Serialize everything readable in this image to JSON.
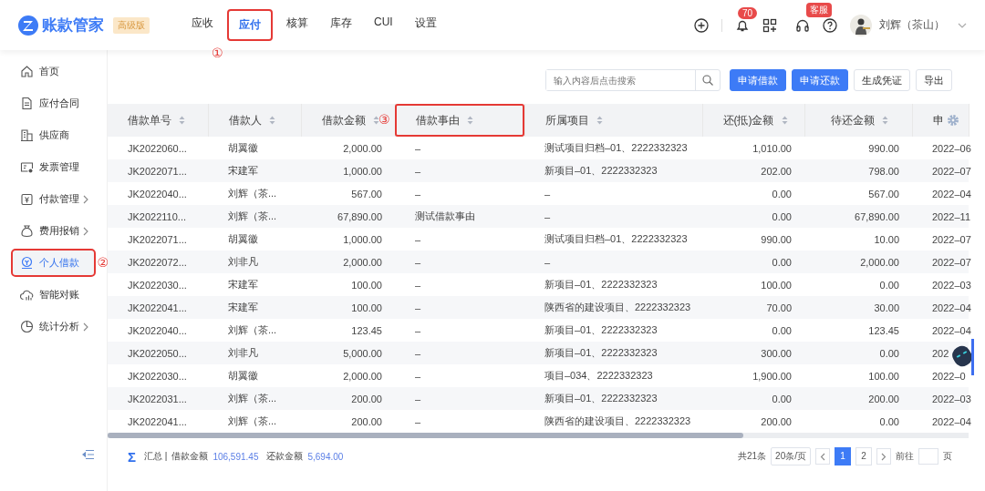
{
  "header": {
    "logo_text": "账款管家",
    "edition_badge": "高级版",
    "nav": [
      {
        "label": "应收",
        "selected": false
      },
      {
        "label": "应付",
        "selected": true,
        "annotation": "①"
      },
      {
        "label": "核算",
        "selected": false
      },
      {
        "label": "库存",
        "selected": false
      },
      {
        "label": "CUI",
        "selected": false
      },
      {
        "label": "设置",
        "selected": false
      }
    ],
    "notification_count": "70",
    "support_badge": "客服",
    "user_name": "刘辉（茶山）"
  },
  "sidebar": {
    "items": [
      {
        "label": "首页",
        "selected": false,
        "has_submenu": false
      },
      {
        "label": "应付合同",
        "selected": false,
        "has_submenu": false
      },
      {
        "label": "供应商",
        "selected": false,
        "has_submenu": false
      },
      {
        "label": "发票管理",
        "selected": false,
        "has_submenu": false
      },
      {
        "label": "付款管理",
        "selected": false,
        "has_submenu": true
      },
      {
        "label": "费用报销",
        "selected": false,
        "has_submenu": true
      },
      {
        "label": "个人借款",
        "selected": true,
        "has_submenu": false,
        "annotation": "②"
      },
      {
        "label": "智能对账",
        "selected": false,
        "has_submenu": false
      },
      {
        "label": "统计分析",
        "selected": false,
        "has_submenu": true
      }
    ]
  },
  "toolbar": {
    "search": {
      "placeholder": "输入内容后点击搜索"
    },
    "buttons": [
      {
        "label": "申请借款",
        "kind": "primary"
      },
      {
        "label": "申请还款",
        "kind": "primary"
      },
      {
        "label": "生成凭证",
        "kind": "plain"
      },
      {
        "label": "导出",
        "kind": "plain"
      }
    ]
  },
  "table": {
    "columns": [
      {
        "label": "借款单号",
        "kind": "text",
        "sortable": true
      },
      {
        "label": "借款人",
        "kind": "text",
        "sortable": true
      },
      {
        "label": "借款金额",
        "kind": "amount",
        "sortable": true
      },
      {
        "label": "借款事由",
        "kind": "text",
        "sortable": true,
        "annotation": "③"
      },
      {
        "label": "所属项目",
        "kind": "text",
        "sortable": true
      },
      {
        "label": "还(抵)金额",
        "kind": "amount",
        "sortable": true
      },
      {
        "label": "待还金额",
        "kind": "amount",
        "sortable": true
      },
      {
        "label": "申",
        "kind": "text",
        "sortable": false
      }
    ],
    "rows": [
      [
        "JK2022060...",
        "胡翼徽",
        "2,000.00",
        "–",
        "测试项目归档–01、2222332323",
        "1,010.00",
        "990.00",
        "2022–06"
      ],
      [
        "JK2022071...",
        "宋建军",
        "1,000.00",
        "–",
        "新项目–01、2222332323",
        "202.00",
        "798.00",
        "2022–07"
      ],
      [
        "JK2022040...",
        "刘辉（茶...",
        "567.00",
        "–",
        "–",
        "0.00",
        "567.00",
        "2022–04"
      ],
      [
        "JK2022110...",
        "刘辉（茶...",
        "67,890.00",
        "测试借款事由",
        "–",
        "0.00",
        "67,890.00",
        "2022–11"
      ],
      [
        "JK2022071...",
        "胡翼徽",
        "1,000.00",
        "–",
        "测试项目归档–01、2222332323",
        "990.00",
        "10.00",
        "2022–07"
      ],
      [
        "JK2022072...",
        "刘非凡",
        "2,000.00",
        "–",
        "–",
        "0.00",
        "2,000.00",
        "2022–07"
      ],
      [
        "JK2022030...",
        "宋建军",
        "100.00",
        "–",
        "新项目–01、2222332323",
        "100.00",
        "0.00",
        "2022–03"
      ],
      [
        "JK2022041...",
        "宋建军",
        "100.00",
        "–",
        "陕西省的建设项目、2222332323",
        "70.00",
        "30.00",
        "2022–04"
      ],
      [
        "JK2022040...",
        "刘辉（茶...",
        "123.45",
        "–",
        "新项目–01、2222332323",
        "0.00",
        "123.45",
        "2022–04"
      ],
      [
        "JK2022050...",
        "刘非凡",
        "5,000.00",
        "–",
        "新项目–01、2222332323",
        "300.00",
        "0.00",
        "202"
      ],
      [
        "JK2022030...",
        "胡翼徽",
        "2,000.00",
        "–",
        "项目–034、2222332323",
        "1,900.00",
        "100.00",
        "2022–0"
      ],
      [
        "JK2022031...",
        "刘辉（茶...",
        "200.00",
        "–",
        "新项目–01、2222332323",
        "0.00",
        "200.00",
        "2022–03"
      ],
      [
        "JK2022041...",
        "刘辉（茶...",
        "200.00",
        "–",
        "陕西省的建设项目、2222332323",
        "200.00",
        "0.00",
        "2022–04"
      ]
    ]
  },
  "summary": {
    "symbol": "Σ",
    "label": "汇总 |",
    "loan_label": "借款金额",
    "loan_total": "106,591.45",
    "repay_label": "还款金额",
    "repay_total": "5,694.00"
  },
  "pagination": {
    "total": "共21条",
    "page_size": "20条/页",
    "pages": [
      {
        "label": "1",
        "selected": true
      },
      {
        "label": "2",
        "selected": false
      }
    ],
    "goto_label": "前往",
    "page_suffix": "页"
  }
}
